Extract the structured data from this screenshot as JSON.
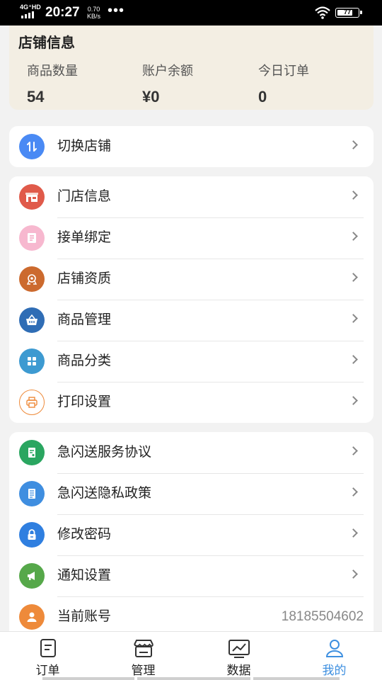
{
  "status_bar": {
    "network": "4G⁺HD",
    "time": "20:27",
    "speed_value": "0.70",
    "speed_unit": "KB/s",
    "dots": "•••",
    "battery": "77"
  },
  "store_info": {
    "title": "店铺信息",
    "stats": [
      {
        "label": "商品数量",
        "value": "54"
      },
      {
        "label": "账户余额",
        "value": "¥0"
      },
      {
        "label": "今日订单",
        "value": "0"
      }
    ]
  },
  "menu": {
    "switch_store": {
      "label": "切换店铺",
      "icon": "switch-icon",
      "color": "#4a8af4"
    },
    "group_store": [
      {
        "label": "门店信息",
        "icon": "storefront-icon",
        "color": "#e05a4a"
      },
      {
        "label": "接单绑定",
        "icon": "document-icon",
        "color": "#f7b8cf"
      },
      {
        "label": "店铺资质",
        "icon": "certificate-icon",
        "color": "#cc6a2e"
      },
      {
        "label": "商品管理",
        "icon": "basket-icon",
        "color": "#2f6db5"
      },
      {
        "label": "商品分类",
        "icon": "grid-icon",
        "color": "#3d9ad1"
      },
      {
        "label": "打印设置",
        "icon": "printer-icon",
        "color": "#ee8a3a"
      }
    ],
    "group_account": [
      {
        "label": "急闪送服务协议",
        "icon": "agreement-icon",
        "color": "#2aa660"
      },
      {
        "label": "急闪送隐私政策",
        "icon": "policy-icon",
        "color": "#3f8ee0"
      },
      {
        "label": "修改密码",
        "icon": "lock-icon",
        "color": "#2f7fe0"
      },
      {
        "label": "通知设置",
        "icon": "megaphone-icon",
        "color": "#56a84a"
      },
      {
        "label": "当前账号",
        "icon": "user-icon",
        "color": "#ee8a3a",
        "value": "18185504602"
      }
    ]
  },
  "tabs": [
    {
      "label": "订单",
      "icon": "order-icon"
    },
    {
      "label": "管理",
      "icon": "manage-icon"
    },
    {
      "label": "数据",
      "icon": "chart-icon"
    },
    {
      "label": "我的",
      "icon": "profile-icon",
      "active": true
    }
  ],
  "colors": {
    "accent": "#3d8fe0",
    "store_card_bg": "#f3eee3"
  }
}
